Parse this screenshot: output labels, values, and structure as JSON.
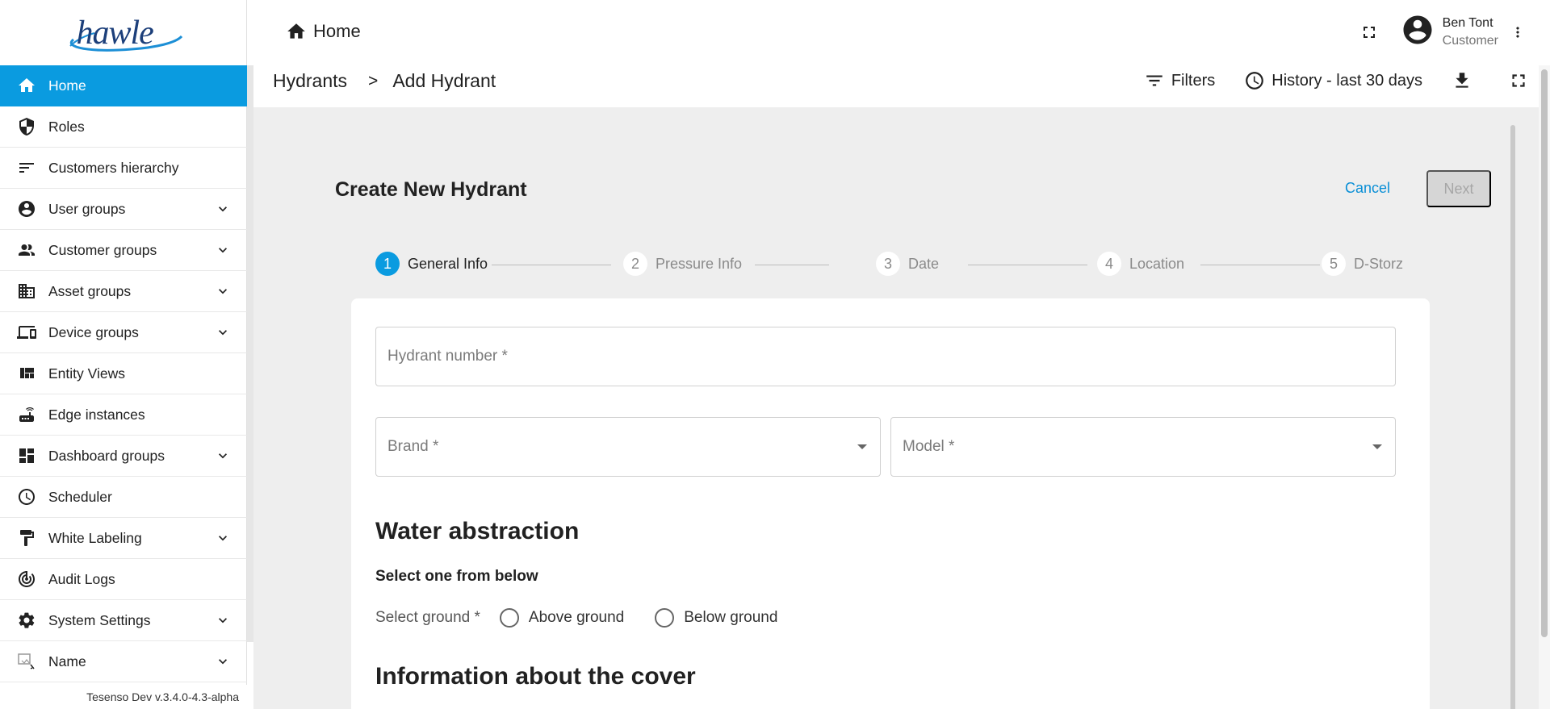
{
  "brand": {
    "logo_text": "hawle"
  },
  "sidebar": {
    "items": [
      {
        "label": "Home",
        "icon": "home-icon",
        "expandable": false,
        "active": true
      },
      {
        "label": "Roles",
        "icon": "shield-icon",
        "expandable": false
      },
      {
        "label": "Customers hierarchy",
        "icon": "sort-icon",
        "expandable": false
      },
      {
        "label": "User groups",
        "icon": "account-circle-icon",
        "expandable": true
      },
      {
        "label": "Customer groups",
        "icon": "people-icon",
        "expandable": true
      },
      {
        "label": "Asset groups",
        "icon": "domain-icon",
        "expandable": true
      },
      {
        "label": "Device groups",
        "icon": "devices-icon",
        "expandable": true
      },
      {
        "label": "Entity Views",
        "icon": "view-quilt-icon",
        "expandable": false
      },
      {
        "label": "Edge instances",
        "icon": "router-icon",
        "expandable": false
      },
      {
        "label": "Dashboard groups",
        "icon": "dashboard-icon",
        "expandable": true
      },
      {
        "label": "Scheduler",
        "icon": "clock-icon",
        "expandable": false
      },
      {
        "label": "White Labeling",
        "icon": "format-paint-icon",
        "expandable": true
      },
      {
        "label": "Audit Logs",
        "icon": "track-changes-icon",
        "expandable": false
      },
      {
        "label": "System Settings",
        "icon": "gear-icon",
        "expandable": true
      },
      {
        "label": "Name",
        "icon": "broken-image-icon",
        "expandable": true
      }
    ],
    "version": "Tesenso Dev v.3.4.0-4.3-alpha"
  },
  "header": {
    "title": "Home",
    "user": {
      "name": "Ben Tont",
      "role": "Customer"
    }
  },
  "breadcrumb": {
    "items": [
      "Hydrants",
      "Add Hydrant"
    ],
    "separator": ">"
  },
  "toolbar": {
    "filters_label": "Filters",
    "history_label": "History - last 30 days"
  },
  "form": {
    "title": "Create New Hydrant",
    "cancel_label": "Cancel",
    "next_label": "Next",
    "steps": [
      {
        "num": "1",
        "label": "General Info",
        "active": true
      },
      {
        "num": "2",
        "label": "Pressure Info"
      },
      {
        "num": "3",
        "label": "Date"
      },
      {
        "num": "4",
        "label": "Location"
      },
      {
        "num": "5",
        "label": "D-Storz"
      }
    ],
    "hydrant_number_placeholder": "Hydrant number *",
    "brand_placeholder": "Brand *",
    "model_placeholder": "Model *",
    "water_abstraction_title": "Water abstraction",
    "select_one_label": "Select one from below",
    "select_ground_label": "Select ground *",
    "ground_options": [
      "Above ground",
      "Below ground"
    ],
    "cover_title": "Information about the cover"
  },
  "colors": {
    "accent": "#0a9be0",
    "link": "#0a8fd6",
    "background": "#eeeeee"
  }
}
